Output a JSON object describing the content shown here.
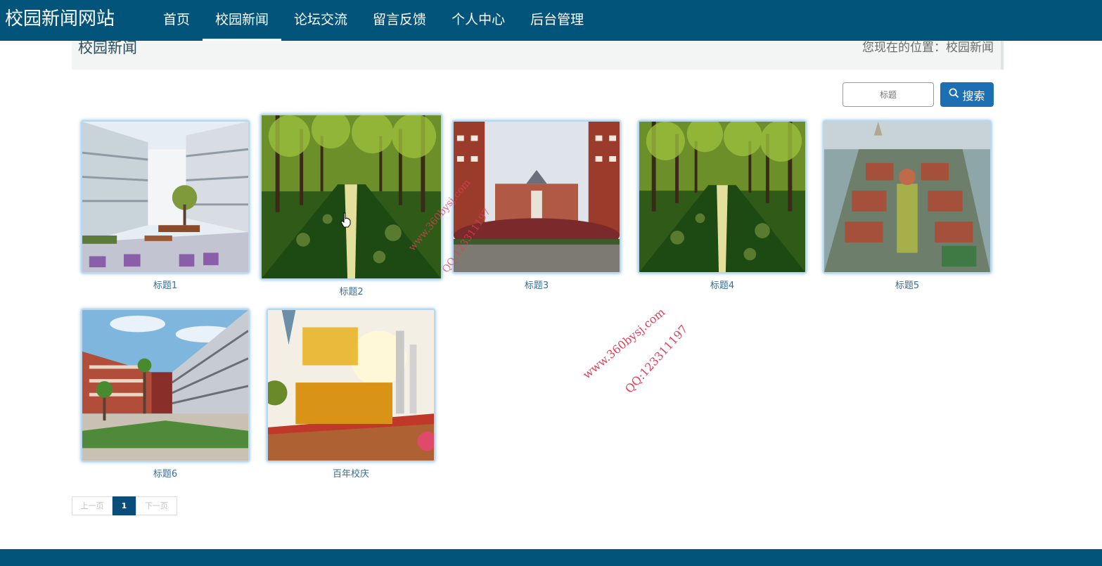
{
  "header": {
    "site_title": "校园新闻网站",
    "nav": [
      {
        "label": "首页"
      },
      {
        "label": "校园新闻"
      },
      {
        "label": "论坛交流"
      },
      {
        "label": "留言反馈"
      },
      {
        "label": "个人中心"
      },
      {
        "label": "后台管理"
      }
    ],
    "active_index": 1
  },
  "breadcrumb": {
    "title": "校园新闻",
    "location": "您现在的位置：校园新闻"
  },
  "search": {
    "placeholder": "标题",
    "button_label": "搜索"
  },
  "news": [
    {
      "title": "标题1",
      "image": "modern-school-courtyard"
    },
    {
      "title": "标题2",
      "image": "tree-lined-campus-road"
    },
    {
      "title": "标题3",
      "image": "red-brick-school-gate"
    },
    {
      "title": "标题4",
      "image": "tree-lined-campus-road"
    },
    {
      "title": "标题5",
      "image": "campus-aerial-view"
    },
    {
      "title": "标题6",
      "image": "curved-school-building"
    },
    {
      "title": "百年校庆",
      "image": "anniversary-sign-爱校荣校"
    }
  ],
  "pagination": {
    "prev": "上一页",
    "current": "1",
    "next": "下一页"
  },
  "watermark": {
    "site": "www.360bysj.com",
    "qq": "QQ:123311197"
  },
  "colors": {
    "header_bg": "#02547a",
    "button_bg": "#1c6fb3",
    "page_active_bg": "#0b4d7a",
    "caption": "#3a6e8f",
    "watermark": "#e0405a"
  }
}
